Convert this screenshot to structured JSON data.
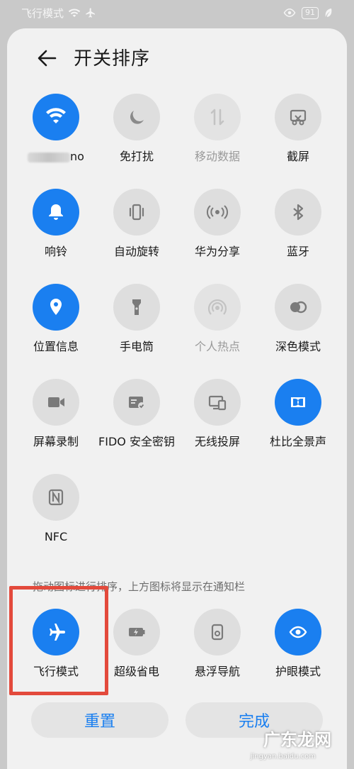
{
  "status_bar": {
    "left_text": "飞行模式",
    "battery": "91"
  },
  "header": {
    "title": "开关排序"
  },
  "tiles": [
    {
      "label": "",
      "label_suffix": "no",
      "icon": "wifi-icon",
      "state": "on"
    },
    {
      "label": "免打扰",
      "icon": "moon-icon",
      "state": "off"
    },
    {
      "label": "移动数据",
      "icon": "mobile-data-icon",
      "state": "dim"
    },
    {
      "label": "截屏",
      "icon": "screenshot-icon",
      "state": "off"
    },
    {
      "label": "响铃",
      "icon": "bell-icon",
      "state": "on"
    },
    {
      "label": "自动旋转",
      "icon": "rotate-icon",
      "state": "off"
    },
    {
      "label": "华为分享",
      "icon": "share-icon",
      "state": "off"
    },
    {
      "label": "蓝牙",
      "icon": "bluetooth-icon",
      "state": "off"
    },
    {
      "label": "位置信息",
      "icon": "location-icon",
      "state": "on"
    },
    {
      "label": "手电筒",
      "icon": "flashlight-icon",
      "state": "off"
    },
    {
      "label": "个人热点",
      "icon": "hotspot-icon",
      "state": "dim"
    },
    {
      "label": "深色模式",
      "icon": "dark-mode-icon",
      "state": "off"
    },
    {
      "label": "屏幕录制",
      "icon": "screen-record-icon",
      "state": "off"
    },
    {
      "label": "FIDO 安全密钥",
      "icon": "fido-key-icon",
      "state": "off"
    },
    {
      "label": "无线投屏",
      "icon": "wireless-projection-icon",
      "state": "off"
    },
    {
      "label": "杜比全景声",
      "icon": "dolby-icon",
      "state": "on"
    },
    {
      "label": "NFC",
      "icon": "nfc-icon",
      "state": "off"
    }
  ],
  "hint": "拖动图标进行排序，上方图标将显示在通知栏",
  "bottom_tiles": [
    {
      "label": "飞行模式",
      "icon": "airplane-icon",
      "state": "on"
    },
    {
      "label": "超级省电",
      "icon": "battery-saver-icon",
      "state": "off"
    },
    {
      "label": "悬浮导航",
      "icon": "floating-nav-icon",
      "state": "off"
    },
    {
      "label": "护眼模式",
      "icon": "eye-comfort-icon",
      "state": "on"
    }
  ],
  "buttons": {
    "reset": "重置",
    "done": "完成"
  },
  "watermark": {
    "main": "广东龙网",
    "sub": "jingyan.baidu.com"
  },
  "colors": {
    "accent": "#1a7ff0",
    "highlight": "#e34a3c",
    "panel": "#f1f1f1"
  }
}
